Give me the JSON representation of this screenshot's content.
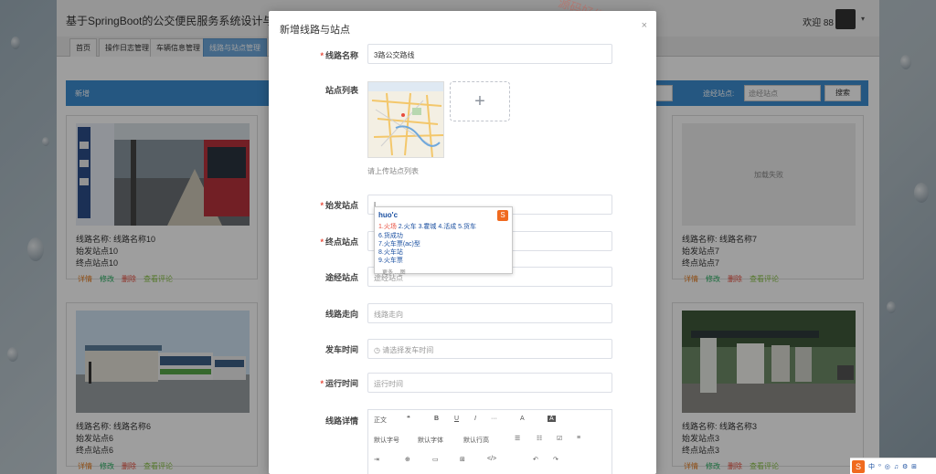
{
  "app": {
    "title": "基于SpringBoot的公交便民服务系统设计与实现",
    "welcome": "欢迎 88",
    "nav_tabs": [
      "首页",
      "操作日志管理",
      "车辆信息管理",
      "线路与站点管理"
    ],
    "toolbar": {
      "add_label": "新增",
      "via_label": "途经站点:",
      "via_placeholder": "途经站点",
      "search_label": "搜索"
    },
    "cards": [
      {
        "name": "线路名称:  线路名称10",
        "start": "始发站点10",
        "end": "终点站点10",
        "image": "bus-station-photo"
      },
      {
        "name": "线路名称:  线路名称7",
        "start": "始发站点7",
        "end": "终点站点7",
        "image": "placeholder",
        "placeholder": "加载失败"
      },
      {
        "name": "线路名称:  线路名称6",
        "start": "始发站点6",
        "end": "终点站点6",
        "image": "buses-photo"
      },
      {
        "name": "线路名称:  线路名称3",
        "start": "始发站点3",
        "end": "终点站点3",
        "image": "bus-shelter-photo"
      }
    ],
    "card_actions": {
      "detail": "详情",
      "edit": "修改",
      "delete": "删除",
      "comment": "查看评论"
    }
  },
  "modal": {
    "title": "新增线路与站点",
    "close": "×",
    "fields": {
      "route_name": {
        "label": "线路名称",
        "required": true,
        "value": "3路公交路线"
      },
      "station_list": {
        "label": "站点列表",
        "tip": "请上传站点列表",
        "add": "+"
      },
      "start_station": {
        "label": "始发站点",
        "required": true,
        "value": "|"
      },
      "end_station": {
        "label": "终点站点",
        "required": true,
        "placeholder": "终点站点"
      },
      "via_station": {
        "label": "途经站点",
        "placeholder": "途经站点"
      },
      "direction": {
        "label": "线路走向",
        "placeholder": "线路走向"
      },
      "depart_time": {
        "label": "发车时间",
        "placeholder": "请选择发车时间"
      },
      "run_time": {
        "label": "运行时间",
        "required": true,
        "placeholder": "运行时间"
      },
      "details": {
        "label": "线路详情"
      }
    },
    "editor_toolbar": {
      "row1": [
        "正文",
        "❝",
        "B",
        "U",
        "I",
        "···",
        "A",
        "A"
      ],
      "row2": [
        "默认字号",
        "默认字体",
        "默认行高"
      ],
      "row3": [
        "⊕",
        "▭",
        "⊞",
        "</>",
        "↶",
        "↷"
      ]
    }
  },
  "ime": {
    "input": "huo'c",
    "line1_selected": "1.火场",
    "line1_rest": "2.火车  3.霍城  4.活成  5.货车",
    "candidates": [
      "6.货成功",
      "7.火车票(ac)型",
      "8.火车站",
      "9.火车票"
    ],
    "footer": "更多  …图"
  },
  "watermark": "源码好优多",
  "colors": {
    "bar": "#3c8dd0",
    "active_tab": "#6fa8dc",
    "required": "#e74c3c"
  }
}
